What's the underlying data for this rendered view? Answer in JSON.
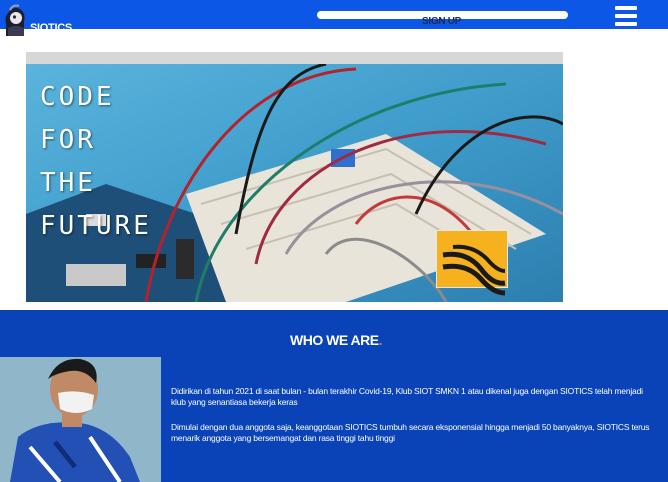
{
  "nav": {
    "logo_text": "SIOTICS",
    "signup_label": "SIGN UP",
    "menu_icon": "hamburger-menu-icon"
  },
  "hero": {
    "lines": [
      "CODE",
      "FOR",
      "THE",
      "FUTURE"
    ],
    "badge_color": "#f6b21e"
  },
  "about": {
    "title": "WHO WE ARE",
    "title_accent": ".",
    "paragraph_1": "Didirikan di tahun 2021 di saat bulan - bulan terakhir Covid-19, Klub SIOT SMKN 1 atau dikenal juga dengan SIOTICS telah menjadi klub yang senantiasa bekerja keras",
    "paragraph_2": "Dimulai dengan dua anggota saja, keanggotaan SIOTICS tumbuh secara eksponensial hingga menjadi 50 banyaknya, SIOTICS terus menarik anggota yang bersemangat dan rasa tinggi tahu tinggi"
  },
  "colors": {
    "nav_bg": "#0d57e6",
    "section_bg": "#0a43b8",
    "accent": "#ff5a5a"
  }
}
